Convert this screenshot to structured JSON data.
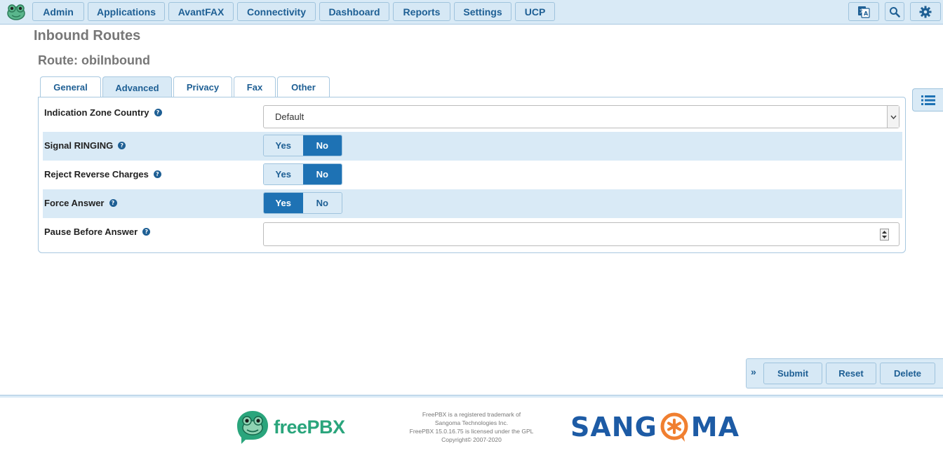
{
  "navbar": {
    "menu": [
      "Admin",
      "Applications",
      "AvantFAX",
      "Connectivity",
      "Dashboard",
      "Reports",
      "Settings",
      "UCP"
    ],
    "icons": [
      "language-icon",
      "search-icon",
      "gear-icon"
    ]
  },
  "page": {
    "title": "Inbound Routes",
    "route_title": "Route: obiInbound"
  },
  "tabs": [
    "General",
    "Advanced",
    "Privacy",
    "Fax",
    "Other"
  ],
  "active_tab": "Advanced",
  "form": {
    "indication_zone": {
      "label": "Indication Zone Country",
      "value": "Default"
    },
    "signal_ringing": {
      "label": "Signal RINGING",
      "yes": "Yes",
      "no": "No",
      "selected": "No"
    },
    "reject_reverse": {
      "label": "Reject Reverse Charges",
      "yes": "Yes",
      "no": "No",
      "selected": "No"
    },
    "force_answer": {
      "label": "Force Answer",
      "yes": "Yes",
      "no": "No",
      "selected": "Yes"
    },
    "pause_before_answer": {
      "label": "Pause Before Answer",
      "value": ""
    },
    "help_glyph": "?"
  },
  "actions": {
    "toggle_glyph": "»",
    "submit": "Submit",
    "reset": "Reset",
    "delete": "Delete"
  },
  "footer": {
    "freepbx_free": "free",
    "freepbx_pbx": "PBX",
    "legal": [
      "FreePBX is a registered trademark of",
      "Sangoma Technologies Inc.",
      "FreePBX 15.0.16.75 is licensed under the GPL",
      "Copyright© 2007-2020"
    ],
    "sangoma_left": "SANG",
    "sangoma_right": "MA"
  },
  "colors": {
    "nav_bg": "#d9eaf6",
    "primary": "#1e72b4",
    "link": "#1e5f94",
    "freepbx_green": "#2aa57c",
    "sangoma_blue": "#1d5ba5",
    "sangoma_orange": "#f07f30"
  }
}
